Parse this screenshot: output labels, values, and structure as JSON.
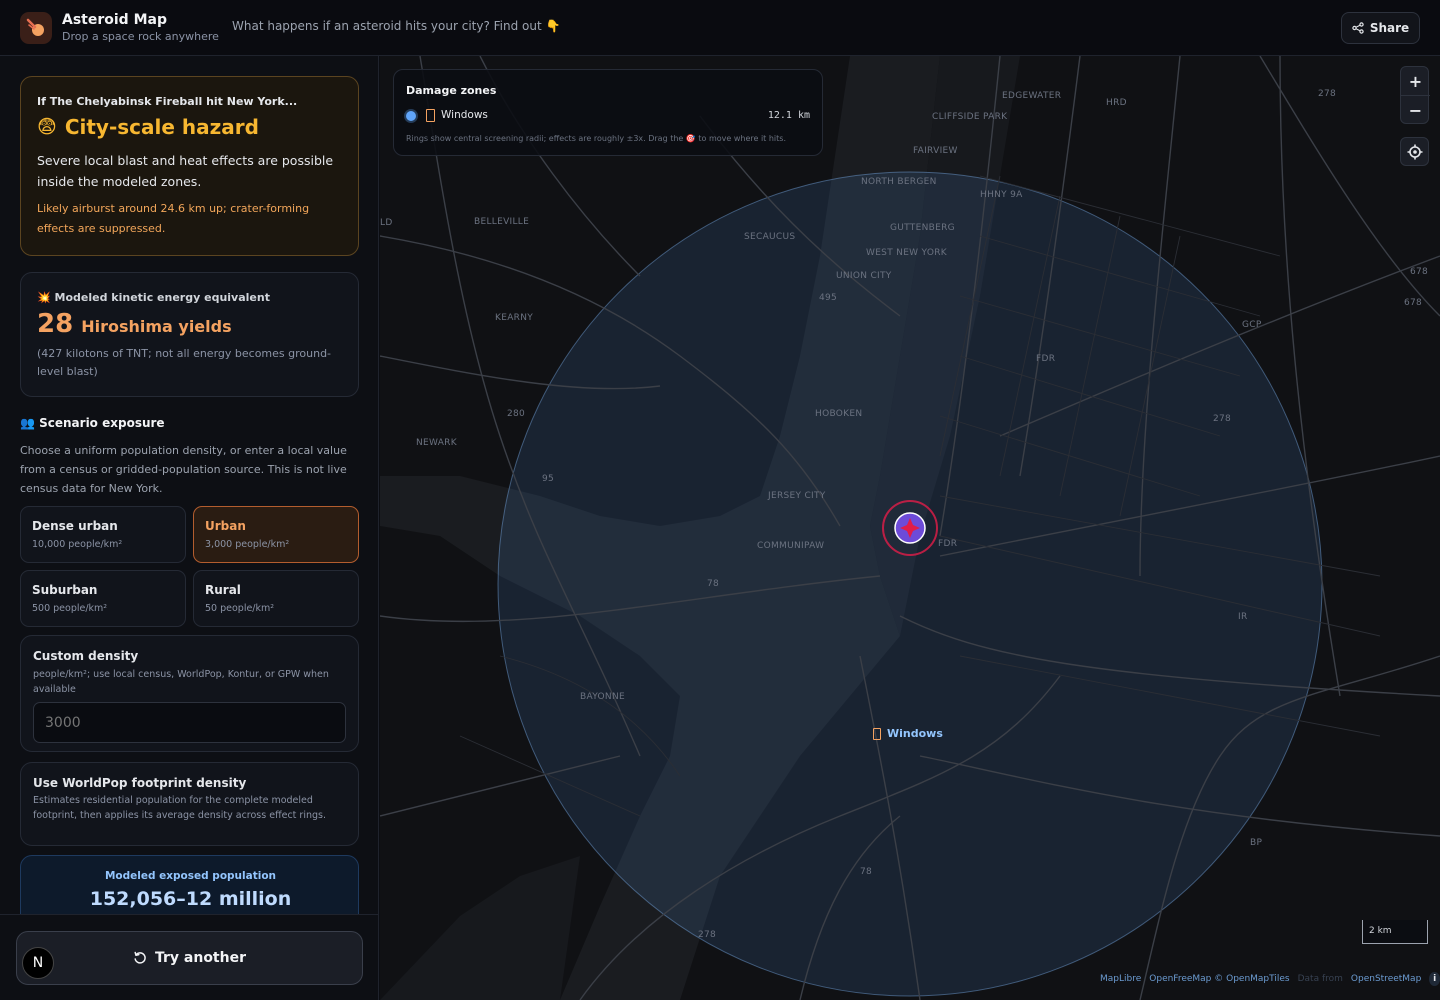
{
  "header": {
    "title": "Asteroid Map",
    "subtitle": "Drop a space rock anywhere",
    "tagline": "What happens if an asteroid hits your city? Find out 👇",
    "share_label": "Share"
  },
  "hazard": {
    "kicker": "If The Chelyabinsk Fireball hit New York...",
    "emoji": "😨",
    "title": "City-scale hazard",
    "description": "Severe local blast and heat effects are possible inside the modeled zones.",
    "note": "Likely airburst around 24.6 km up; crater-forming effects are suppressed."
  },
  "energy": {
    "label": "💥 Modeled kinetic energy equivalent",
    "value": "28",
    "unit": "Hiroshima yields",
    "note": "(427 kilotons of TNT; not all energy becomes ground-level blast)"
  },
  "exposure": {
    "heading": "👥 Scenario exposure",
    "description": "Choose a uniform population density, or enter a local value from a census or gridded-population source. This is not live census data for New York.",
    "options": [
      {
        "label": "Dense urban",
        "density": "10,000 people/km²",
        "active": false
      },
      {
        "label": "Urban",
        "density": "3,000 people/km²",
        "active": true
      },
      {
        "label": "Suburban",
        "density": "500 people/km²",
        "active": false
      },
      {
        "label": "Rural",
        "density": "50 people/km²",
        "active": false
      }
    ],
    "custom": {
      "title": "Custom density",
      "help": "people/km²; use local census, WorldPop, Kontur, or GPW when available",
      "placeholder": "3000"
    },
    "worldpop": {
      "title": "Use WorldPop footprint density",
      "help": "Estimates residential population for the complete modeled footprint, then applies its average density across effect rings."
    },
    "population": {
      "label": "Modeled exposed population",
      "value": "152,056–12 million"
    }
  },
  "footer": {
    "try_label": "Try another",
    "badge": "N"
  },
  "zones_panel": {
    "title": "Damage zones",
    "zone_name": "Windows",
    "zone_distance": "12.1 km",
    "note": "Rings show central screening radii; effects are roughly ±3x. Drag the 🎯 to move where it hits."
  },
  "map": {
    "zone_label": "Windows",
    "scale": "2 km",
    "attribution": [
      "MapLibre",
      "OpenFreeMap © OpenMapTiles",
      "Data from",
      "OpenStreetMap"
    ],
    "places": [
      "EDGEWATER",
      "CLIFFSIDE PARK",
      "FAIRVIEW",
      "NORTH BERGEN",
      "BELLEVILLE",
      "SECAUCUS",
      "GUTTENBERG",
      "WEST NEW YORK",
      "UNION CITY",
      "KEARNY",
      "HOBOKEN",
      "NEWARK",
      "JERSEY CITY",
      "COMMUNIPAW",
      "BAYONNE",
      "LD",
      "HRD",
      "HHNY 9A"
    ],
    "roads": [
      "495",
      "280",
      "95",
      "78",
      "278",
      "278",
      "278",
      "GCP",
      "FDR",
      "FDR",
      "BP",
      "678",
      "678",
      "IR",
      "78"
    ]
  },
  "colors": {
    "accent": "#f4a261",
    "hazard": "#f7b731",
    "zone": "#60a5fa",
    "impact": "#e11d48"
  }
}
